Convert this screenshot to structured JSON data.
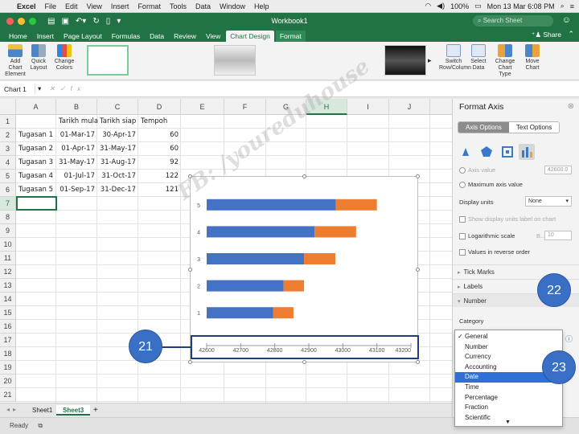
{
  "menubar": {
    "app": "Excel",
    "items": [
      "File",
      "Edit",
      "View",
      "Insert",
      "Format",
      "Tools",
      "Data",
      "Window",
      "Help"
    ],
    "battery": "100%",
    "clock": "Mon 13 Mar  6:08 PM"
  },
  "window": {
    "title": "Workbook1",
    "search_placeholder": "Search Sheet"
  },
  "ribbon_tabs": {
    "items": [
      "Home",
      "Insert",
      "Page Layout",
      "Formulas",
      "Data",
      "Review",
      "View",
      "Chart Design",
      "Format"
    ],
    "active": "Chart Design",
    "share": "Share"
  },
  "ribbon": {
    "add_chart_element": "Add Chart Element",
    "quick_layout": "Quick Layout",
    "change_colors": "Change Colors",
    "switch_row_column": "Switch Row/Column",
    "select_data": "Select Data",
    "change_chart_type": "Change Chart Type",
    "move_chart": "Move Chart"
  },
  "formula_bar": {
    "name_box": "Chart 1",
    "fx": "fx"
  },
  "sheet": {
    "columns": [
      "A",
      "B",
      "C",
      "D",
      "E",
      "F",
      "G",
      "H",
      "I",
      "J"
    ],
    "selected_column": "H",
    "rows": [
      "1",
      "2",
      "3",
      "4",
      "5",
      "6",
      "7",
      "8",
      "9",
      "10",
      "11",
      "12",
      "13",
      "14",
      "15",
      "16",
      "17",
      "18",
      "19",
      "20",
      "21"
    ],
    "selected_row": "7",
    "header": [
      "",
      "Tarikh mula",
      "Tarikh siap",
      "Tempoh"
    ],
    "data": [
      [
        "Tugasan 1",
        "01-Mar-17",
        "30-Apr-17",
        "60"
      ],
      [
        "Tugasan 2",
        "01-Apr-17",
        "31-May-17",
        "60"
      ],
      [
        "Tugasan 3",
        "31-May-17",
        "31-Aug-17",
        "92"
      ],
      [
        "Tugasan 4",
        "01-Jul-17",
        "31-Oct-17",
        "122"
      ],
      [
        "Tugasan 5",
        "01-Sep-17",
        "31-Dec-17",
        "121"
      ]
    ]
  },
  "chart_data": {
    "type": "bar",
    "orientation": "horizontal",
    "stacked": true,
    "categories": [
      "1",
      "2",
      "3",
      "4",
      "5"
    ],
    "series": [
      {
        "values": [
          42795,
          42826,
          42886,
          42917,
          42979
        ],
        "color": "#4472c4"
      },
      {
        "values": [
          60,
          60,
          92,
          122,
          121
        ],
        "color": "#ed7d31"
      }
    ],
    "xlim": [
      42600,
      43200
    ],
    "xticks": [
      "42600",
      "42700",
      "42800",
      "42900",
      "43000",
      "43100",
      "43200"
    ],
    "grid": false,
    "legend": "none"
  },
  "sheet_tabs": {
    "items": [
      "Sheet1",
      "Sheet3"
    ],
    "active": "Sheet3",
    "add": "+"
  },
  "status": {
    "text": "Ready"
  },
  "format_pane": {
    "title": "Format Axis",
    "tabs": [
      "Axis Options",
      "Text Options"
    ],
    "active_tab": "Axis Options",
    "axis_value_label": "Axis value",
    "axis_value_box": "42600.0",
    "max_axis_value": "Maximum axis value",
    "display_units_label": "Display units",
    "display_units_value": "None",
    "show_units_label": "Show display units label on chart",
    "log_scale_label": "Logarithmic scale",
    "log_base_label": "B...",
    "log_base_value": "10",
    "reverse_label": "Values in reverse order",
    "sections": [
      "Tick Marks",
      "Labels",
      "Number"
    ],
    "category_label": "Category"
  },
  "dropdown": {
    "options": [
      "General",
      "Number",
      "Currency",
      "Accounting",
      "Date",
      "Time",
      "Percentage",
      "Fraction",
      "Scientific"
    ],
    "checked": "General",
    "highlighted": "Date",
    "more_arrow": "▼"
  },
  "annotations": {
    "a21": "21",
    "a22": "22",
    "a23": "23"
  },
  "watermark": "FB: /youreduhouse",
  "colors": {
    "excel_green": "#217346",
    "bar_blue": "#4472c4",
    "bar_orange": "#ed7d31",
    "bubble": "#3a6fc6",
    "highlight": "#2f6fd6"
  }
}
